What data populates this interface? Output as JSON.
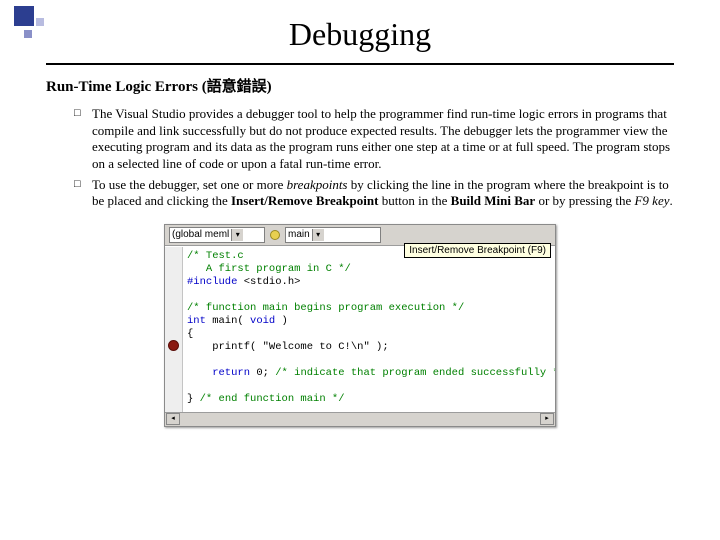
{
  "title": "Debugging",
  "subheading": "Run-Time Logic Errors (語意錯誤)",
  "bullets": {
    "b1": {
      "pre": "The Visual Studio provides a debugger tool to help the programmer find run-time logic errors in programs that compile and link successfully but do not produce expected results. The debugger lets the programmer view the executing program and its data as the program runs either one step at a time or at full speed. The program stops on a selected line of code or upon a fatal run-time error."
    },
    "b2": {
      "pre": "To use the debugger, set one or more ",
      "em1": "breakpoints",
      "mid1": " by clicking the line in the program where the breakpoint is to be placed and clicking the ",
      "bold1": "Insert/Remove Breakpoint",
      "mid2": " button in the ",
      "bold2": "Build Mini Bar",
      "mid3": " or by pressing the ",
      "em2": "F9 key",
      "post": "."
    }
  },
  "shot": {
    "dropdown1": "(global meml",
    "dropdown2": "main",
    "tooltip": "Insert/Remove Breakpoint (F9)",
    "code": {
      "l1": "/* Test.c",
      "l2": "   A first program in C */",
      "l3a": "#include ",
      "l3b": "<stdio.h>",
      "l4": "",
      "l5": "/* function main begins program execution */",
      "l6a": "int",
      "l6b": " main( ",
      "l6c": "void",
      "l6d": " )",
      "l7": "{",
      "l8a": "    printf( ",
      "l8b": "\"Welcome to C!\\n\"",
      "l8c": " );",
      "l9": "",
      "l10a": "    return",
      "l10b": " 0; ",
      "l10c": "/* indicate that program ended successfully */",
      "l11": "",
      "l12a": "} ",
      "l12b": "/* end function main */"
    }
  }
}
